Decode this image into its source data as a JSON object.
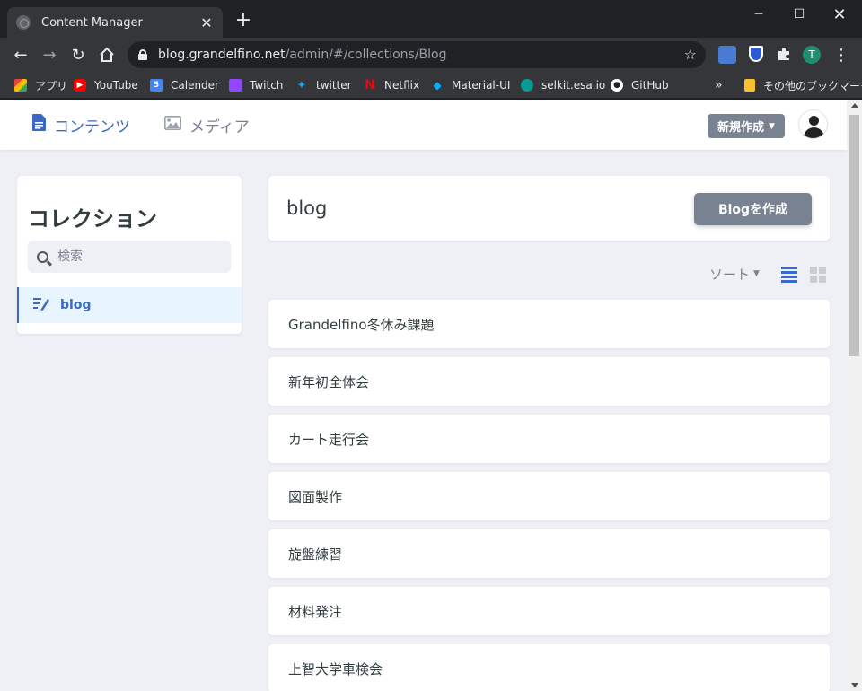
{
  "browser": {
    "tab_title": "Content Manager",
    "url_host": "blog.grandelfino.net",
    "url_path": "/admin/#/collections/Blog",
    "profile_initial": "T",
    "bookmarks": [
      {
        "label": "アプリ",
        "icon": "apps-grid-icon",
        "color": "#ea4335"
      },
      {
        "label": "YouTube",
        "icon": "youtube-icon",
        "color": "#ff0000"
      },
      {
        "label": "Calender",
        "icon": "calendar-icon",
        "color": "#4285f4"
      },
      {
        "label": "Twitch",
        "icon": "twitch-icon",
        "color": "#9146ff"
      },
      {
        "label": "twitter",
        "icon": "twitter-icon",
        "color": "#1da1f2"
      },
      {
        "label": "Netflix",
        "icon": "netflix-icon",
        "color": "#e50914"
      },
      {
        "label": "Material-UI",
        "icon": "material-ui-icon",
        "color": "#00b0ff"
      },
      {
        "label": "selkit.esa.io",
        "icon": "esa-icon",
        "color": "#0a9b94"
      },
      {
        "label": "GitHub",
        "icon": "github-icon",
        "color": "#ffffff"
      }
    ],
    "overflow_label": "»",
    "other_bookmarks": "その他のブックマーク"
  },
  "app": {
    "nav_contents": "コンテンツ",
    "nav_media": "メディア",
    "new_button": "新規作成",
    "sidebar_title": "コレクション",
    "search_placeholder": "検索",
    "collections": [
      {
        "label": "blog"
      }
    ],
    "collection_title": "blog",
    "create_button": "Blogを作成",
    "sort_label": "ソート",
    "entries": [
      "Grandelfino冬休み課題",
      "新年初全体会",
      "カート走行会",
      "図面製作",
      "旋盤練習",
      "材料発注",
      "上智大学車検会"
    ]
  },
  "colors": {
    "accent": "#3a69c7",
    "button_gray": "#798291",
    "page_bg": "#eff0f5"
  }
}
